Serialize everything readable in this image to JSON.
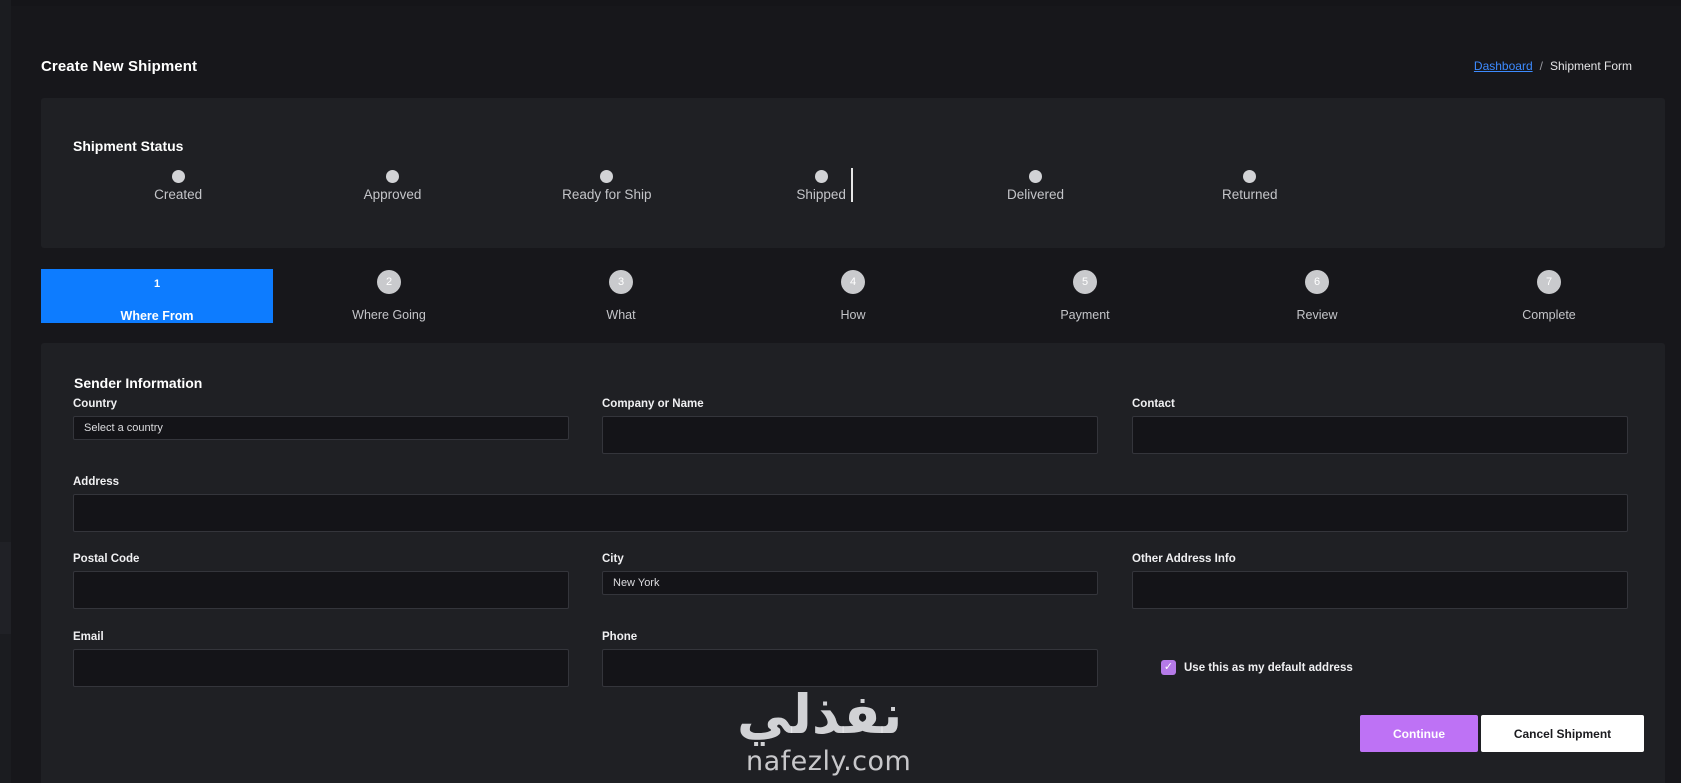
{
  "header": {
    "title": "Create New Shipment",
    "breadcrumb": {
      "link": "Dashboard",
      "separator": "/",
      "current": "Shipment Form"
    }
  },
  "status": {
    "title": "Shipment Status",
    "steps": [
      "Created",
      "Approved",
      "Ready for Ship",
      "Shipped",
      "Delivered",
      "Returned"
    ],
    "current_after_index": 2
  },
  "wizard": {
    "active_index": 0,
    "steps": [
      {
        "num": "1",
        "label": "Where From"
      },
      {
        "num": "2",
        "label": "Where Going"
      },
      {
        "num": "3",
        "label": "What"
      },
      {
        "num": "4",
        "label": "How"
      },
      {
        "num": "5",
        "label": "Payment"
      },
      {
        "num": "6",
        "label": "Review"
      },
      {
        "num": "7",
        "label": "Complete"
      }
    ]
  },
  "form": {
    "title": "Sender Information",
    "country": {
      "label": "Country",
      "value": "Select a country"
    },
    "company": {
      "label": "Company or Name",
      "value": ""
    },
    "contact": {
      "label": "Contact",
      "value": ""
    },
    "address": {
      "label": "Address",
      "value": ""
    },
    "postal_code": {
      "label": "Postal Code",
      "value": ""
    },
    "city": {
      "label": "City",
      "value": "New York"
    },
    "other_address": {
      "label": "Other Address Info",
      "value": ""
    },
    "email": {
      "label": "Email",
      "value": ""
    },
    "phone": {
      "label": "Phone",
      "value": ""
    },
    "default_address": {
      "label": "Use this as my default address",
      "checked": true
    },
    "continue_label": "Continue",
    "cancel_label": "Cancel Shipment"
  },
  "watermark": {
    "arabic": "نفذلي",
    "latin": "nafezly.com"
  },
  "colors": {
    "accent_blue": "#0d7cff",
    "accent_purple": "#be72f5",
    "link": "#3d8bff"
  }
}
